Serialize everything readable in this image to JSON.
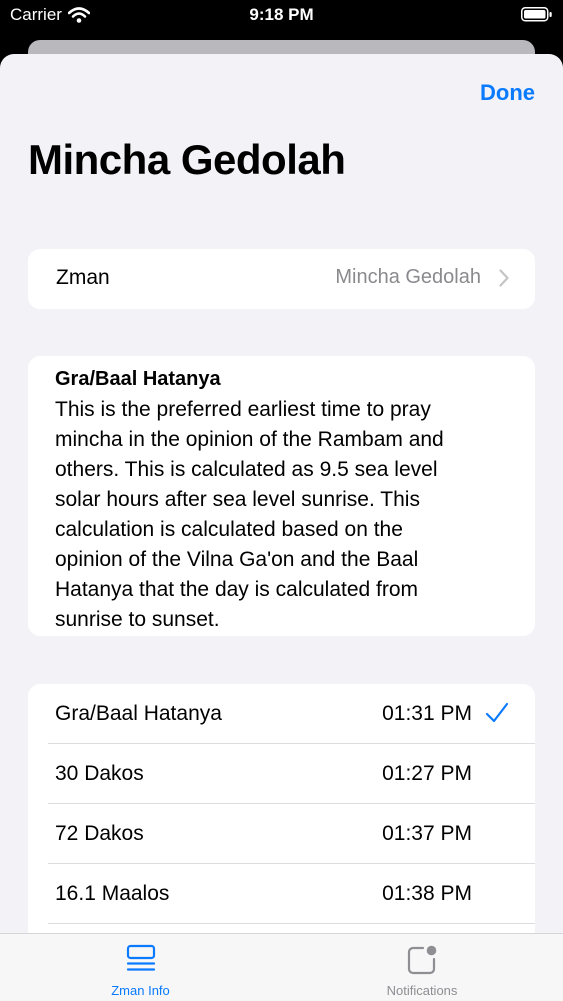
{
  "status_bar": {
    "carrier": "Carrier",
    "time": "9:18 PM"
  },
  "sheet": {
    "done_label": "Done",
    "title": "Mincha Gedolah",
    "zman_row": {
      "label": "Zman",
      "value": "Mincha Gedolah"
    },
    "description": {
      "title": "Gra/Baal Hatanya",
      "lines": [
        "This is the preferred earliest time to pray",
        "mincha in the opinion of the Rambam and",
        "others. This is calculated as 9.5 sea level",
        "solar hours after sea level sunrise. This",
        "calculation is calculated based on the",
        "opinion of the Vilna Ga'on and the Baal",
        "Hatanya that the day is calculated from",
        "sunrise to sunset."
      ]
    },
    "opinions": [
      {
        "name": "Gra/Baal Hatanya",
        "time": "01:31 PM",
        "selected": true
      },
      {
        "name": "30 Dakos",
        "time": "01:27 PM",
        "selected": false
      },
      {
        "name": "72 Dakos",
        "time": "01:37 PM",
        "selected": false
      },
      {
        "name": "16.1 Maalos",
        "time": "01:38 PM",
        "selected": false
      }
    ]
  },
  "tab_bar": {
    "tabs": [
      {
        "label": "Zman Info",
        "icon": "list-icon",
        "active": true
      },
      {
        "label": "Notifications",
        "icon": "notification-badge-icon",
        "active": false
      }
    ]
  },
  "colors": {
    "accent": "#0a7aff",
    "background": "#f2f2f7",
    "secondary_text": "#8a8a8e",
    "inactive_tab": "#8e8e93"
  }
}
